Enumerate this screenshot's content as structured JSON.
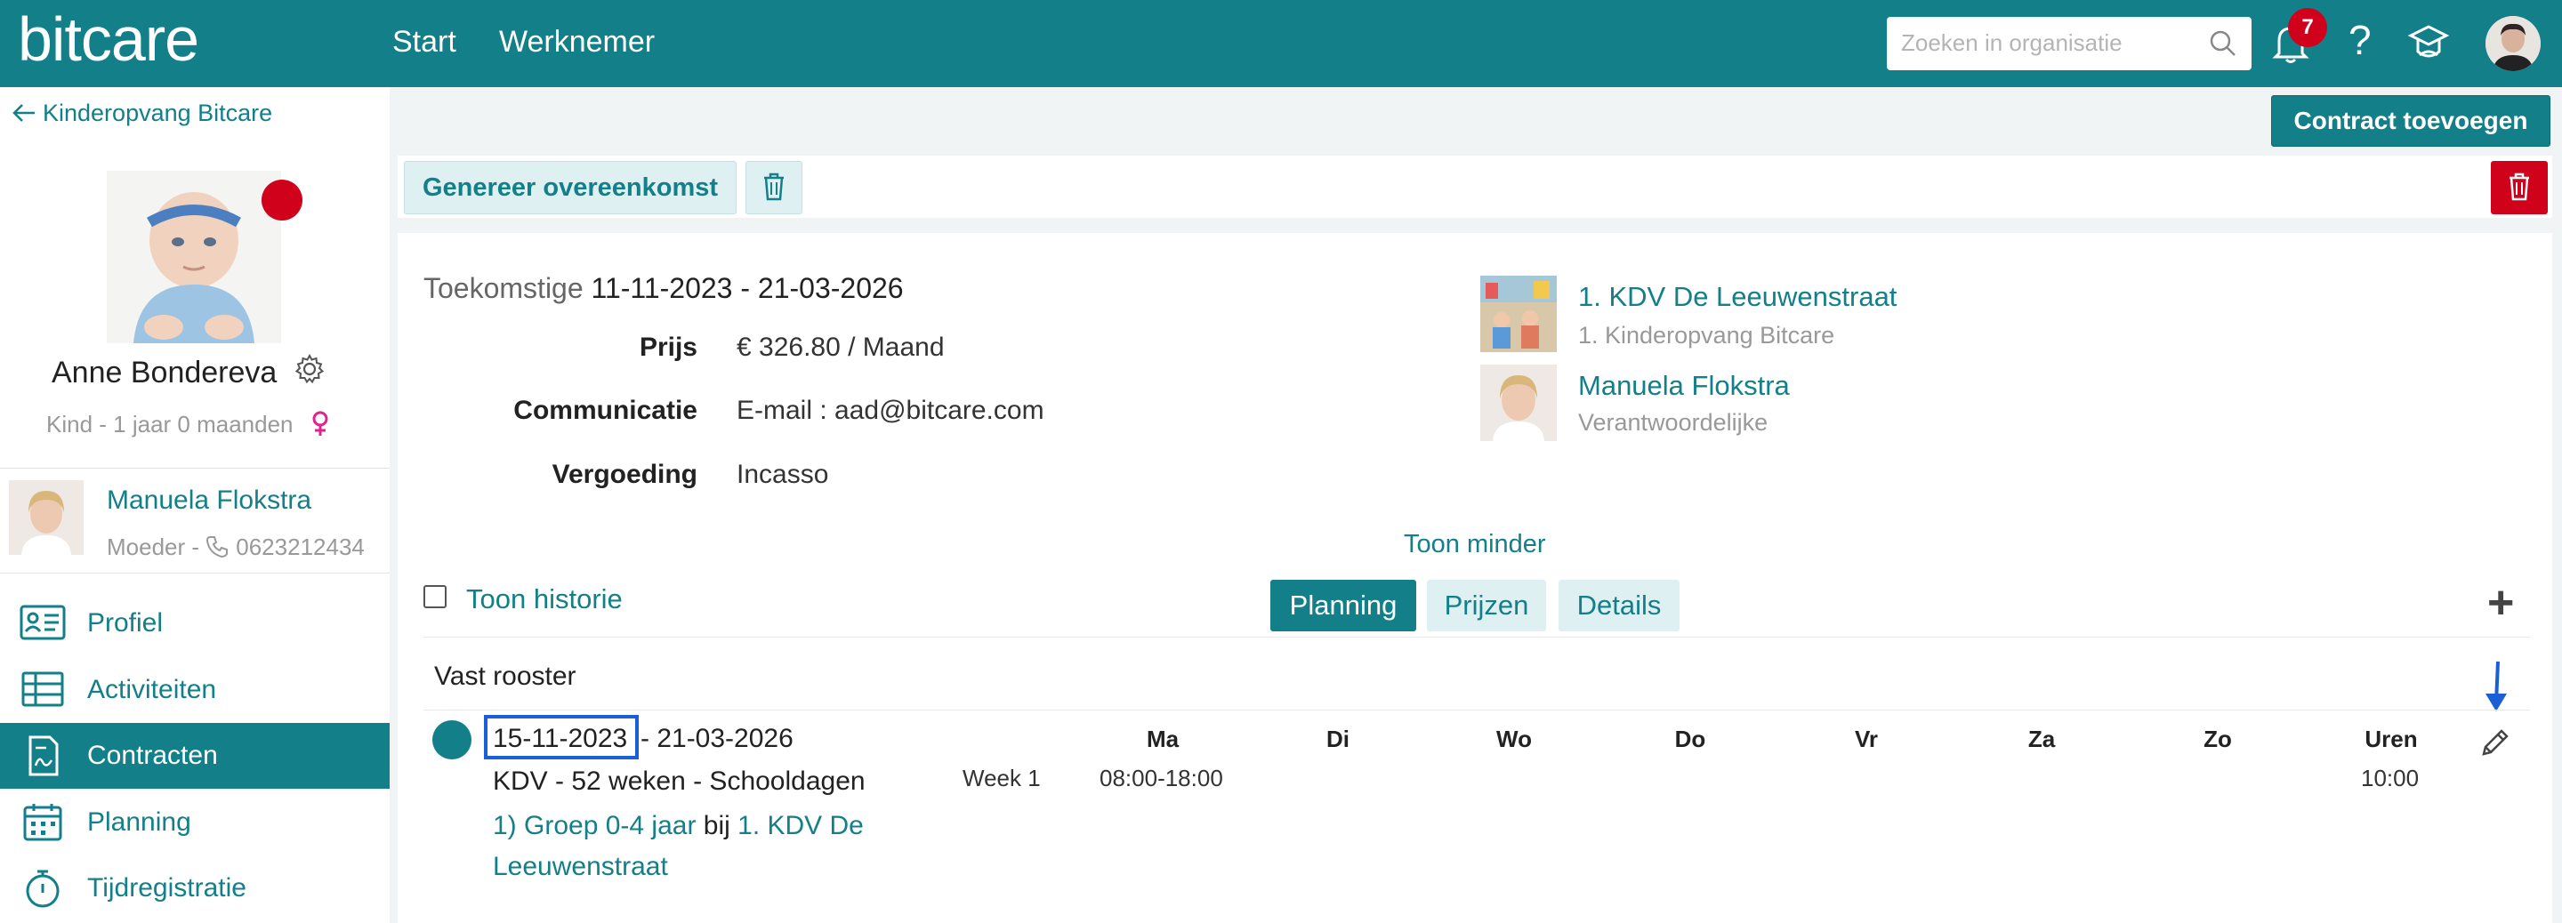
{
  "topbar": {
    "logo": "bitcare",
    "nav": [
      "Start",
      "Werknemer"
    ],
    "search_placeholder": "Zoeken in organisatie",
    "notifications_count": "7",
    "help": "?"
  },
  "sidebar": {
    "back_label": "Kinderopvang Bitcare",
    "child_name": "Anne Bondereva",
    "child_sub": "Kind - 1 jaar 0 maanden",
    "parent_name": "Manuela Flokstra",
    "parent_sub": "Moeder - ",
    "parent_phone": "0623212434",
    "menu": [
      {
        "label": "Profiel",
        "icon": "profile-card-icon"
      },
      {
        "label": "Activiteiten",
        "icon": "table-icon"
      },
      {
        "label": "Contracten",
        "icon": "contract-icon",
        "active": true
      },
      {
        "label": "Planning",
        "icon": "calendar-icon"
      },
      {
        "label": "Tijdregistratie",
        "icon": "stopwatch-icon"
      }
    ]
  },
  "actions": {
    "add_contract": "Contract toevoegen",
    "generate": "Genereer overeenkomst"
  },
  "contract": {
    "status": "Toekomstige",
    "period": "11-11-2023 - 21-03-2026",
    "fields": [
      {
        "label": "Prijs",
        "value": "€ 326.80 / Maand"
      },
      {
        "label": "Communicatie",
        "value": "E-mail : aad@bitcare.com"
      },
      {
        "label": "Vergoeding",
        "value": "Incasso"
      }
    ],
    "location_title": "1. KDV De Leeuwenstraat",
    "location_sub": "1. Kinderopvang Bitcare",
    "responsible_name": "Manuela Flokstra",
    "responsible_sub": "Verantwoordelijke",
    "toggle_less": "Toon minder",
    "show_history": "Toon historie",
    "tabs": [
      "Planning",
      "Prijzen",
      "Details"
    ],
    "active_tab": "Planning"
  },
  "schedule": {
    "title": "Vast rooster",
    "start": "15-11-2023",
    "end": "- 21-03-2026",
    "type": "KDV - 52 weken - Schooldagen",
    "group": "1) Groep 0-4 jaar",
    "at": " bij ",
    "location": "1. KDV De Leeuwenstraat",
    "days": [
      "Ma",
      "Di",
      "Wo",
      "Do",
      "Vr",
      "Za",
      "Zo"
    ],
    "hours_label": "Uren",
    "week": "Week 1",
    "monday_time": "08:00-18:00",
    "hours": "10:00"
  },
  "colors": {
    "brand": "#127f89",
    "danger": "#d0021b",
    "highlight": "#1a5fd6"
  }
}
